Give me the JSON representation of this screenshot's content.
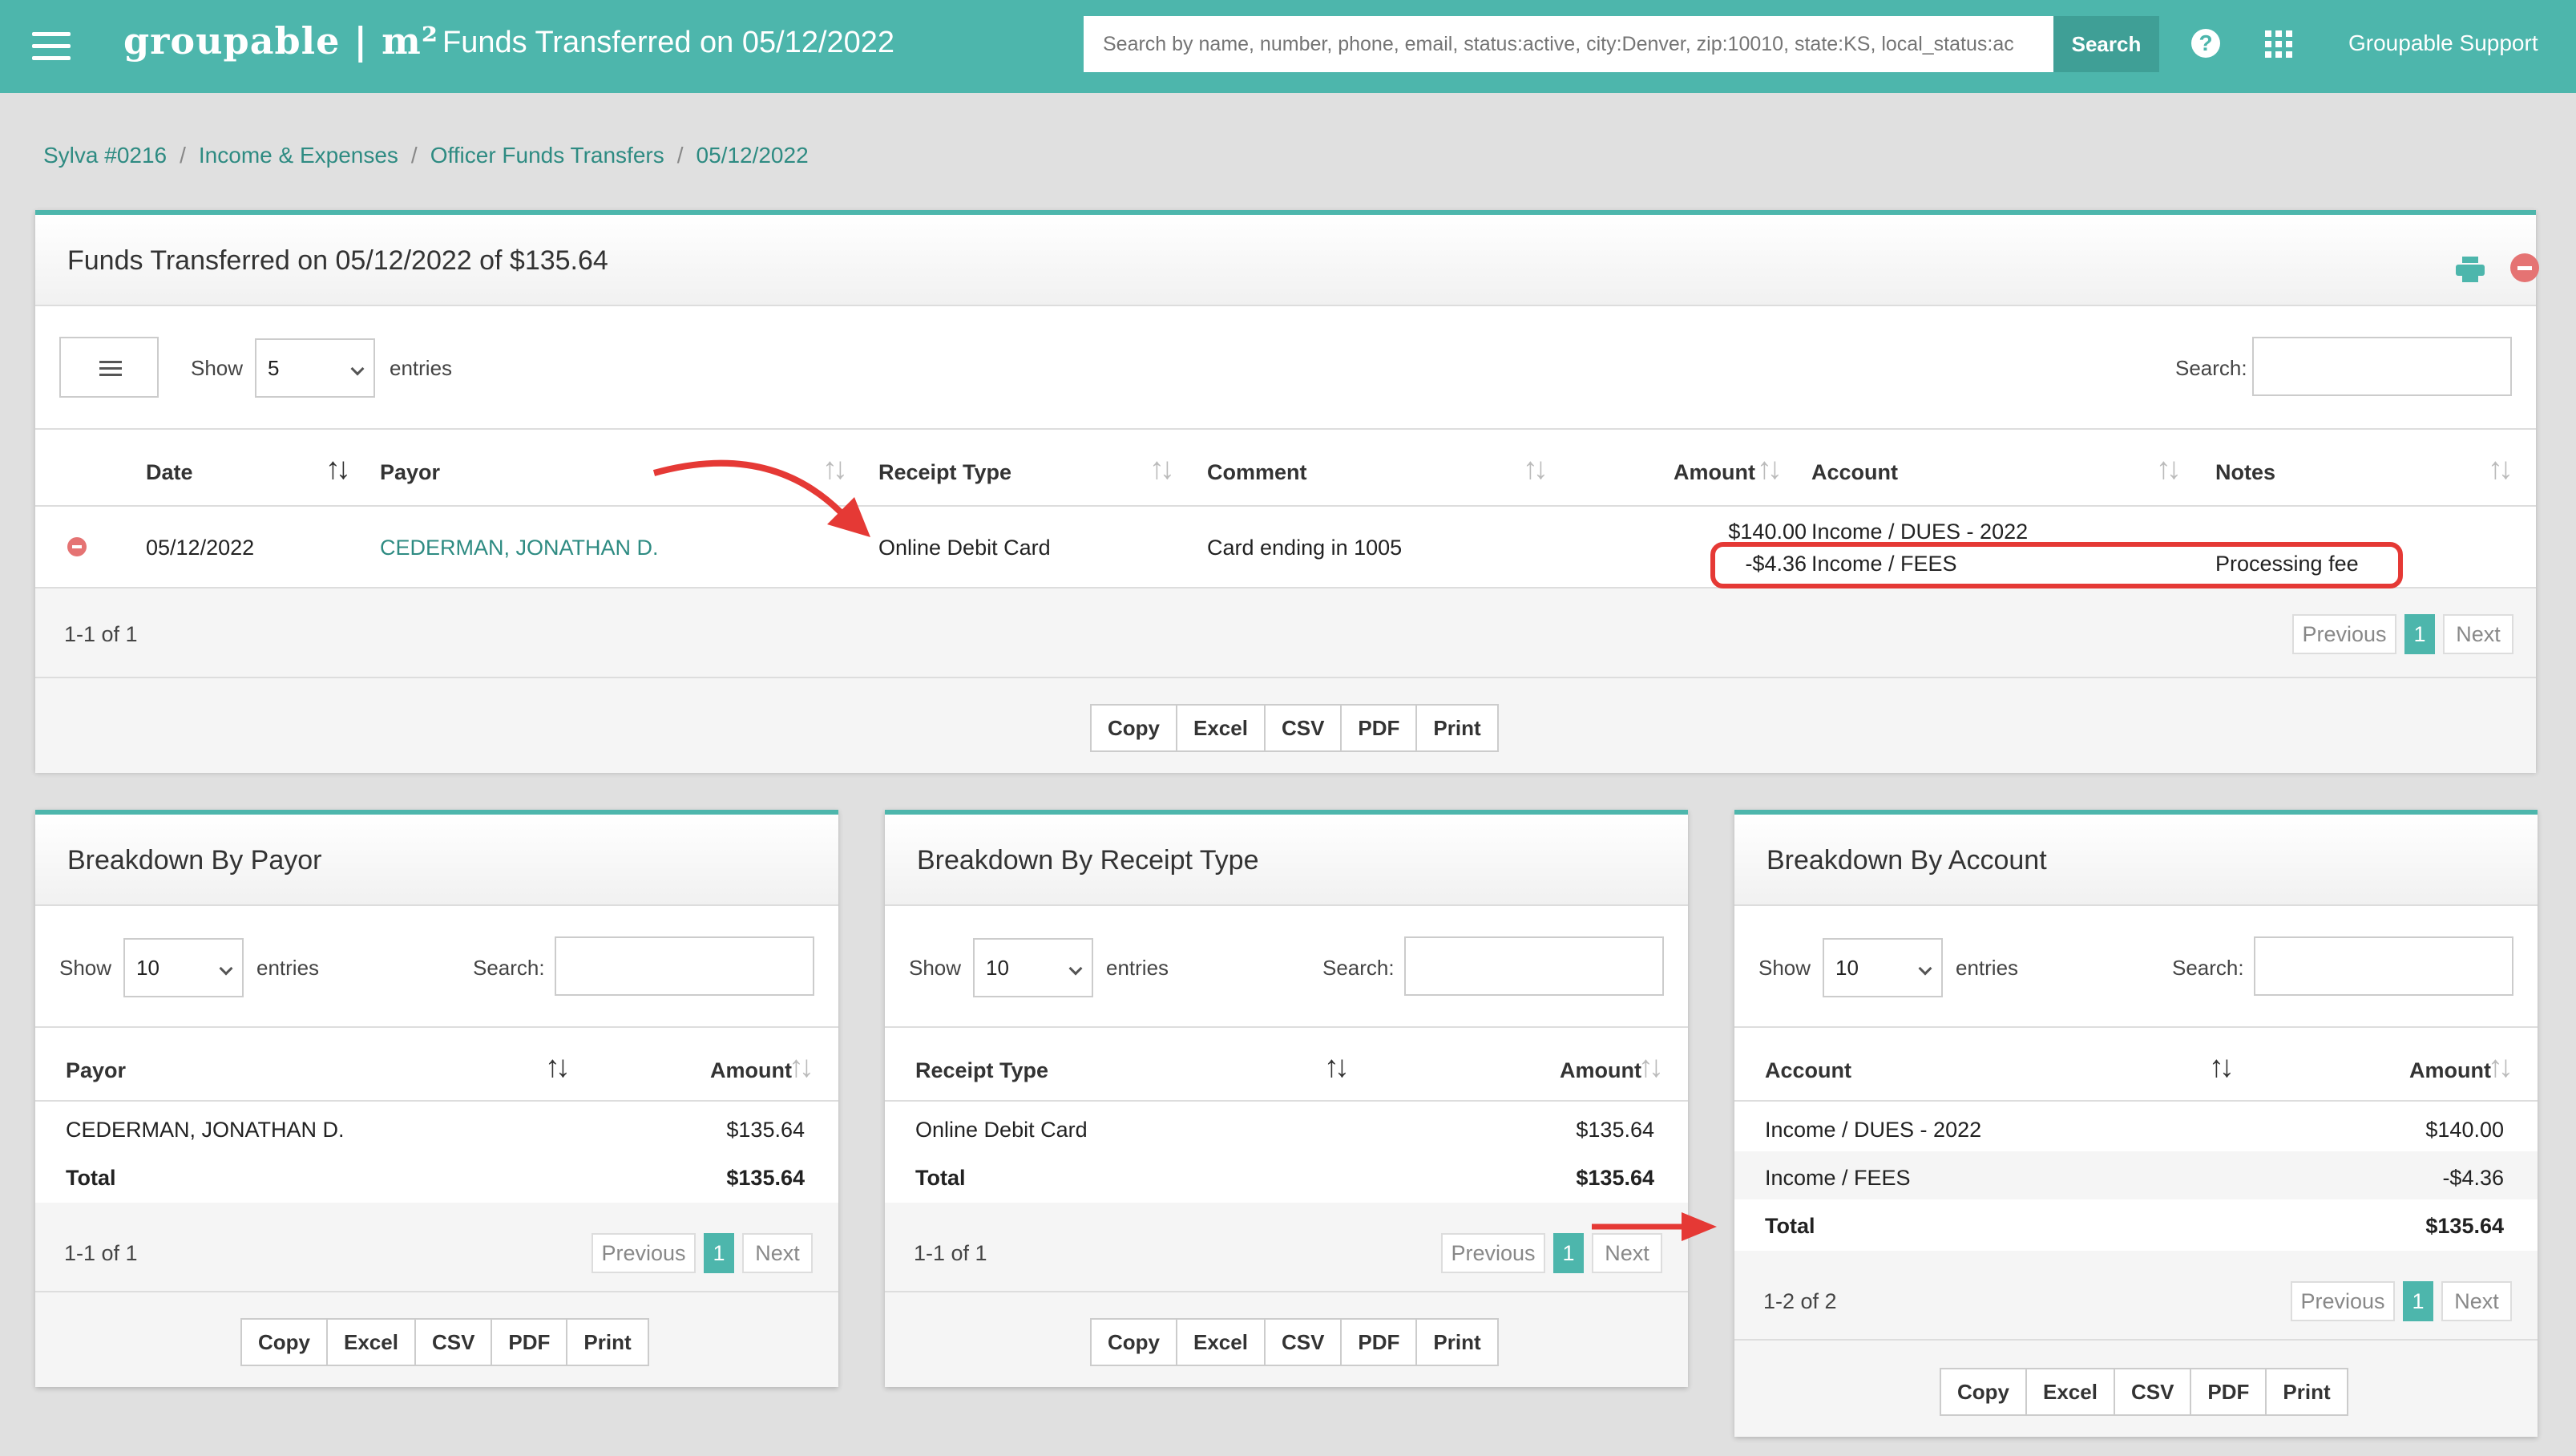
{
  "topbar": {
    "brand": "groupable | m²",
    "title": "Funds Transferred on 05/12/2022",
    "search_placeholder": "Search by name, number, phone, email, status:active, city:Denver, zip:10010, state:KS, local_status:ac",
    "search_button": "Search",
    "help": "?",
    "support": "Groupable Support"
  },
  "breadcrumb": [
    "Sylva #0216",
    "Income & Expenses",
    "Officer Funds Transfers",
    "05/12/2022"
  ],
  "main": {
    "title": "Funds Transferred on 05/12/2022 of $135.64",
    "show_label": "Show",
    "entries_label": "entries",
    "page_size": "5",
    "search_label": "Search:",
    "columns": [
      "Date",
      "Payor",
      "Receipt Type",
      "Comment",
      "Amount",
      "Account",
      "Notes"
    ],
    "row": {
      "date": "05/12/2022",
      "payor": "CEDERMAN, JONATHAN D.",
      "receipt_type": "Online Debit Card",
      "comment": "Card ending in 1005",
      "lines": [
        {
          "amount": "$140.00",
          "account": "Income / DUES - 2022",
          "notes": ""
        },
        {
          "amount": "-$4.36",
          "account": "Income / FEES",
          "notes": "Processing fee"
        }
      ]
    },
    "info": "1-1 of 1",
    "previous": "Previous",
    "page": "1",
    "next": "Next",
    "exports": [
      "Copy",
      "Excel",
      "CSV",
      "PDF",
      "Print"
    ]
  },
  "payor_panel": {
    "title": "Breakdown By Payor",
    "show_label": "Show",
    "page_size": "10",
    "entries_label": "entries",
    "search_label": "Search:",
    "columns": [
      "Payor",
      "Amount"
    ],
    "rows": [
      {
        "label": "CEDERMAN, JONATHAN D.",
        "amount": "$135.64"
      }
    ],
    "total_label": "Total",
    "total": "$135.64",
    "info": "1-1 of 1",
    "previous": "Previous",
    "page": "1",
    "next": "Next",
    "exports": [
      "Copy",
      "Excel",
      "CSV",
      "PDF",
      "Print"
    ]
  },
  "receipt_panel": {
    "title": "Breakdown By Receipt Type",
    "show_label": "Show",
    "page_size": "10",
    "entries_label": "entries",
    "search_label": "Search:",
    "columns": [
      "Receipt Type",
      "Amount"
    ],
    "rows": [
      {
        "label": "Online Debit Card",
        "amount": "$135.64"
      }
    ],
    "total_label": "Total",
    "total": "$135.64",
    "info": "1-1 of 1",
    "previous": "Previous",
    "page": "1",
    "next": "Next",
    "exports": [
      "Copy",
      "Excel",
      "CSV",
      "PDF",
      "Print"
    ]
  },
  "account_panel": {
    "title": "Breakdown By Account",
    "show_label": "Show",
    "page_size": "10",
    "entries_label": "entries",
    "search_label": "Search:",
    "columns": [
      "Account",
      "Amount"
    ],
    "rows": [
      {
        "label": "Income / DUES - 2022",
        "amount": "$140.00"
      },
      {
        "label": "Income / FEES",
        "amount": "-$4.36"
      }
    ],
    "total_label": "Total",
    "total": "$135.64",
    "info": "1-2 of 2",
    "previous": "Previous",
    "page": "1",
    "next": "Next",
    "exports": [
      "Copy",
      "Excel",
      "CSV",
      "PDF",
      "Print"
    ]
  },
  "colors": {
    "accent": "#4db6ac",
    "link": "#2e8b82",
    "annotation": "#e53935"
  },
  "icons": [
    "menu-icon",
    "help-icon",
    "apps-grid-icon",
    "print-icon",
    "close-icon",
    "list-icon",
    "sort-icon",
    "remove-icon"
  ]
}
